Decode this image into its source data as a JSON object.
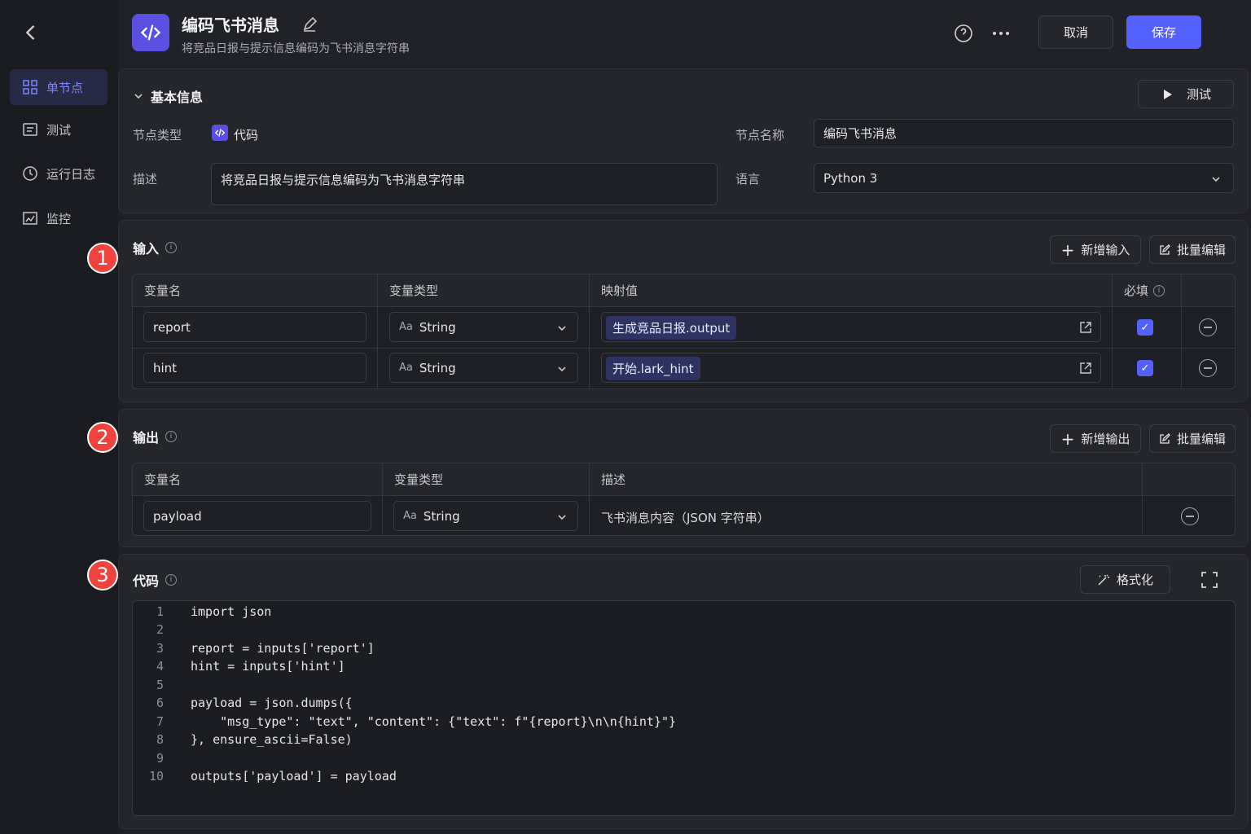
{
  "sidebar": {
    "items": [
      {
        "label": "单节点"
      },
      {
        "label": "测试"
      },
      {
        "label": "运行日志"
      },
      {
        "label": "监控"
      }
    ]
  },
  "header": {
    "title": "编码飞书消息",
    "subtitle": "将竞品日报与提示信息编码为飞书消息字符串",
    "cancel": "取消",
    "save": "保存"
  },
  "basic": {
    "section": "基本信息",
    "test": "测试",
    "node_type_label": "节点类型",
    "node_type": "代码",
    "node_name_label": "节点名称",
    "node_name": "编码飞书消息",
    "desc_label": "描述",
    "desc": "将竞品日报与提示信息编码为飞书消息字符串",
    "lang_label": "语言",
    "lang": "Python 3"
  },
  "input": {
    "title": "输入",
    "badge": "1",
    "add": "新增输入",
    "batch": "批量编辑",
    "headers": [
      "变量名",
      "变量类型",
      "映射值",
      "必填"
    ],
    "rows": [
      {
        "name": "report",
        "type": "String",
        "map": "生成竞品日报.output"
      },
      {
        "name": "hint",
        "type": "String",
        "map": "开始.lark_hint"
      }
    ]
  },
  "output": {
    "title": "输出",
    "badge": "2",
    "add": "新增输出",
    "batch": "批量编辑",
    "headers": [
      "变量名",
      "变量类型",
      "描述"
    ],
    "rows": [
      {
        "name": "payload",
        "type": "String",
        "desc": "飞书消息内容（JSON 字符串）"
      }
    ]
  },
  "code": {
    "title": "代码",
    "badge": "3",
    "format": "格式化",
    "lines": [
      "import json",
      "",
      "report = inputs['report']",
      "hint = inputs['hint']",
      "",
      "payload = json.dumps({",
      "    \"msg_type\": \"text\", \"content\": {\"text\": f\"{report}\\n\\n{hint}\"}",
      "}, ensure_ascii=False)",
      "",
      "outputs['payload'] = payload"
    ]
  },
  "ui": {
    "type_prefix": "Aa",
    "info": "i",
    "check": "✓"
  }
}
